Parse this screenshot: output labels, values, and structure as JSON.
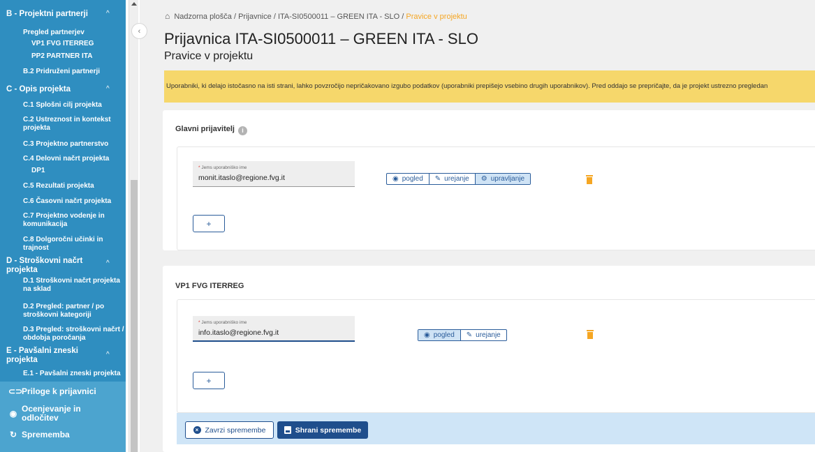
{
  "sidebar": {
    "sections": [
      {
        "title": "B - Projektni partnerji",
        "items": [
          "Pregled partnerjev",
          "VP1 FVG ITERREG",
          "PP2 PARTNER ITA",
          "B.2 Pridruženi partnerji"
        ]
      },
      {
        "title": "C - Opis projekta",
        "items": [
          "C.1 Splošni cilj projekta",
          "C.2 Ustreznost in kontekst projekta",
          "C.3 Projektno partnerstvo",
          "C.4 Delovni načrt projekta",
          "DP1",
          "C.5 Rezultati projekta",
          "C.6 Časovni načrt projekta",
          "C.7 Projektno vodenje in komunikacija",
          "C.8 Dolgoročni učinki in trajnost"
        ]
      },
      {
        "title": "D - Stroškovni načrt projekta",
        "items": [
          "D.1 Stroškovni načrt projekta na sklad",
          "D.2 Pregled: partner / po stroškovni kategoriji",
          "D.3 Pregled: stroškovni načrt / obdobja poročanja"
        ]
      },
      {
        "title": "E - Pavšalni zneski projekta",
        "items": [
          "E.1 - Pavšalni zneski projekta"
        ]
      }
    ],
    "main_items": [
      {
        "label": "Priloge k prijavnici",
        "icon": "paperclip-icon"
      },
      {
        "label": "Ocenjevanje in odločitev",
        "icon": "eye-icon"
      },
      {
        "label": "Sprememba",
        "icon": "refresh-icon"
      }
    ]
  },
  "breadcrumb": {
    "home": "Nadzorna plošča",
    "items": [
      "Prijavnice",
      "ITA-SI0500011 – GREEN ITA - SLO"
    ],
    "current": "Pravice v projektu",
    "separator": "/"
  },
  "page": {
    "title": "Prijavnica ITA-SI0500011 – GREEN ITA - SLO",
    "subtitle": "Pravice v projektu"
  },
  "alert": {
    "text": "Uporabniki, ki delajo istočasno na isti strani, lahko povzročijo nepričakovano izgubo podatkov (uporabniki prepišejo vsebino drugih uporabnikov). Pred oddajo se prepričajte, da je projekt ustrezno pregledan"
  },
  "cards": [
    {
      "title": "Glavni prijavitelj",
      "field_label": "Jems uporabniško ime",
      "field_value": "monit.itaslo@regione.fvg.it",
      "permissions": {
        "view": "pogled",
        "edit": "urejanje",
        "manage": "upravljanje"
      },
      "add_label": "+"
    },
    {
      "title": "VP1 FVG ITERREG",
      "field_label": "Jems uporabniško ime",
      "field_value": "info.itaslo@regione.fvg.it",
      "permissions": {
        "view": "pogled",
        "edit": "urejanje"
      },
      "add_label": "+"
    }
  ],
  "footer": {
    "cancel_label": "Zavrzi spremembe",
    "save_label": "Shrani spremembe"
  },
  "colors": {
    "sidebar": "#4ca4cf",
    "sidebar_sub": "#2f8ec0",
    "accent": "#1f4e8c",
    "warning": "#f6d76b",
    "breadcrumb_current": "#f5a623"
  }
}
